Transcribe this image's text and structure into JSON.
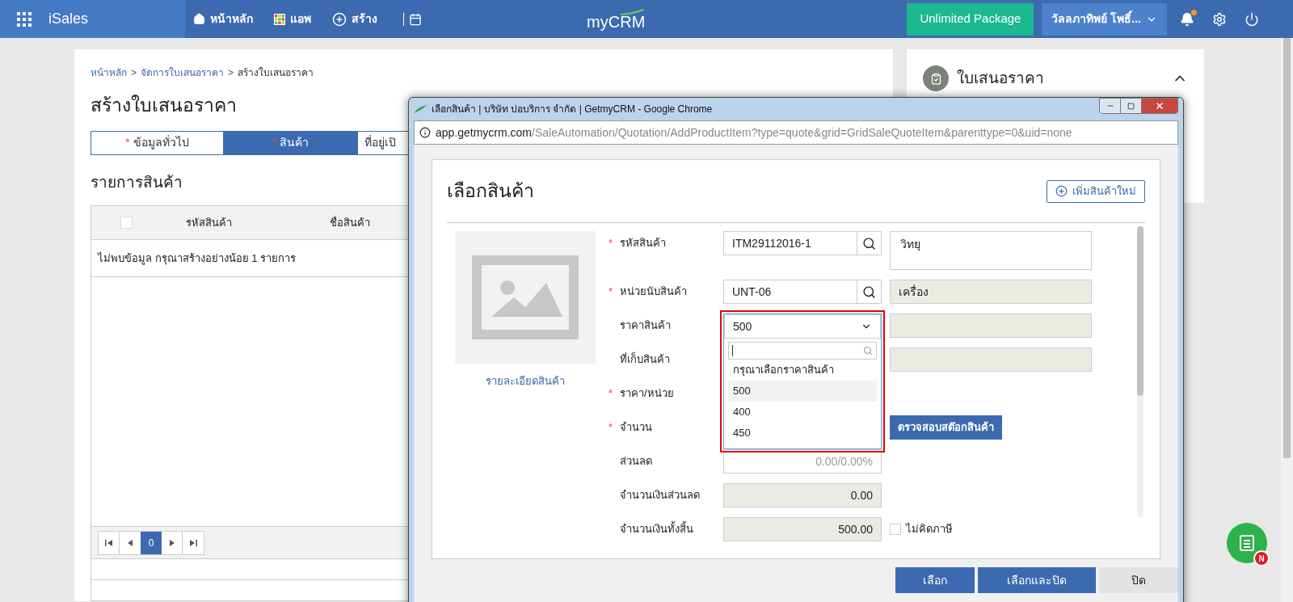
{
  "topbar": {
    "app_name": "iSales",
    "nav": [
      {
        "kind": "home",
        "label": "หน้าหลัก"
      },
      {
        "kind": "apps",
        "label": "แอพ"
      },
      {
        "kind": "create",
        "label": "สร้าง"
      }
    ],
    "logo": "myCRM",
    "package_button": "Unlimited Package",
    "user": "วัลลภาทิพย์ โพธิ์...",
    "has_notification": true
  },
  "page": {
    "breadcrumb": [
      {
        "kind": "link",
        "text": "หน้าหลัก"
      },
      {
        "kind": "separator",
        "text": ">"
      },
      {
        "kind": "link",
        "text": "จัดการใบเสนอราคา"
      },
      {
        "kind": "separator",
        "text": ">"
      },
      {
        "kind": "current",
        "text": "สร้างใบเสนอราคา"
      }
    ],
    "title": "สร้างใบเสนอราคา",
    "tabs": [
      {
        "label": "ข้อมูลทั่วไป",
        "marker": "*",
        "selected": false
      },
      {
        "label": "สินค้า",
        "marker": "*",
        "selected": true
      },
      {
        "label": "ที่อยู่เปิ",
        "selected": false
      }
    ],
    "section_title": "รายการสินค้า",
    "select_all_checked": false,
    "columns": [
      "รหัสสินค้า",
      "ชื่อสินค้า"
    ],
    "empty_message": "ไม่พบข้อมูล กรุณาสร้างอย่างน้อย 1 รายการ",
    "pager_page": "0"
  },
  "right_panel": {
    "title": "ใบเสนอราคา",
    "expanded": true
  },
  "notes_badge": "N",
  "popup": {
    "window_title": "เลือกสินค้า | บริษัท ปอบริการ จำกัด | GetmyCRM - Google Chrome",
    "url_host": "app.getmycrm.com",
    "url_path": "/SaleAutomation/Quotation/AddProductItem?type=quote&grid=GridSaleQuoteItem&parenttype=0&uid=none",
    "heading": "เลือกสินค้า",
    "add_button": "เพิ่มสินค้าใหม่",
    "image_link": "รายละเอียดสินค้า",
    "fields": [
      {
        "label": "รหัสสินค้า",
        "marker": "*",
        "kind": "lookup",
        "value": "ITM29112016-1",
        "side": {
          "kind": "textarea",
          "value": "วิทยุ"
        }
      },
      {
        "label": "หน่วยนับสินค้า",
        "marker": "*",
        "kind": "lookup",
        "value": "UNT-06",
        "side": {
          "kind": "readonly",
          "value": "เครื่อง"
        }
      },
      {
        "label": "ราคาสินค้า",
        "kind": "select",
        "value": "500",
        "open": true,
        "side": {
          "kind": "readonly"
        }
      },
      {
        "label": "ที่เก็บสินค้า",
        "kind": "covered",
        "side": {
          "kind": "readonly"
        }
      },
      {
        "label": "ราคา/หน่วย",
        "marker": "*",
        "kind": "covered"
      },
      {
        "label": "จำนวน",
        "marker": "*",
        "kind": "covered",
        "side": {
          "kind": "button",
          "value": "ตรวจสอบสต๊อกสินค้า"
        }
      },
      {
        "label": "ส่วนลด",
        "kind": "input",
        "value": "0.00/0.00%"
      },
      {
        "label": "จำนวนเงินส่วนลด",
        "kind": "readonly",
        "value": "0.00"
      },
      {
        "label": "จำนวนเงินทั้งสิ้น",
        "kind": "readonly",
        "value": "500.00",
        "side": {
          "kind": "checkbox",
          "value": "ไม่คิดภาษี",
          "checked": false
        }
      }
    ],
    "dropdown": {
      "options": [
        {
          "label": "กรุณาเลือกราคาสินค้า",
          "selected": false
        },
        {
          "label": "500",
          "selected": true
        },
        {
          "label": "400",
          "selected": false
        },
        {
          "label": "450",
          "selected": false
        }
      ]
    },
    "buttons": [
      {
        "label": "เลือก",
        "kind": "primary"
      },
      {
        "label": "เลือกและปิด",
        "kind": "primary"
      },
      {
        "label": "ปิด",
        "kind": "secondary"
      }
    ]
  }
}
